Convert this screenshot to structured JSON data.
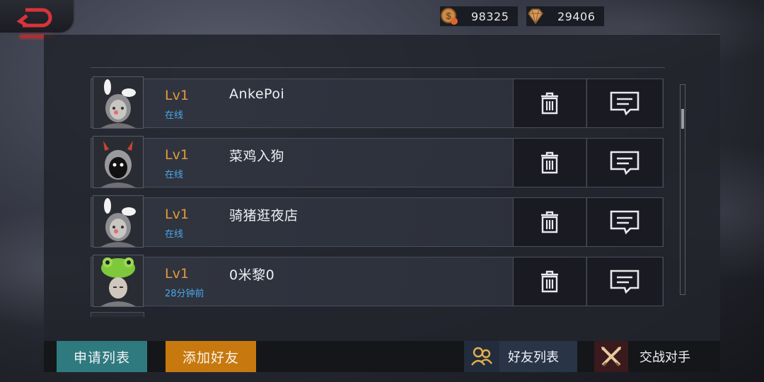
{
  "header": {
    "coins": "98325",
    "gems": "29406"
  },
  "friends": [
    {
      "level": "Lv1",
      "status": "在线",
      "name": "AnkePoi",
      "avatar": "bunny-hat-avatar"
    },
    {
      "level": "Lv1",
      "status": "在线",
      "name": "菜鸡入狗",
      "avatar": "devil-horns-avatar"
    },
    {
      "level": "Lv1",
      "status": "在线",
      "name": "骑猪逛夜店",
      "avatar": "bunny-hat-avatar"
    },
    {
      "level": "Lv1",
      "status": "28分钟前",
      "name": "0米黎0",
      "avatar": "frog-hat-avatar"
    }
  ],
  "bottom": {
    "apply_list": "申请列表",
    "add_friend": "添加好友",
    "friend_list": "好友列表",
    "battle_opponent": "交战对手"
  },
  "colors": {
    "level": "#e39a3a",
    "status": "#4aa8ea",
    "apply_button": "#2f7a7f",
    "add_button": "#c7790f",
    "back_accent": "#c0282c"
  },
  "icons": {
    "back": "back-arrow-icon",
    "coins": "coin-icon",
    "gems": "gem-icon",
    "delete": "trash-icon",
    "message": "chat-icon",
    "friends": "friends-icon",
    "battle": "crossed-swords-icon"
  }
}
